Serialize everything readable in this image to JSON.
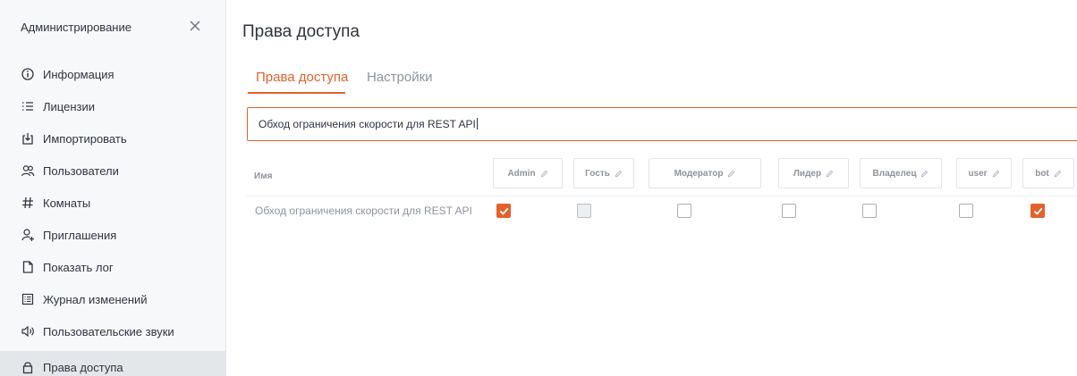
{
  "sidebar": {
    "title": "Администрирование",
    "items": [
      {
        "label": "Информация",
        "icon": "info-icon"
      },
      {
        "label": "Лицензии",
        "icon": "list-icon"
      },
      {
        "label": "Импортировать",
        "icon": "import-icon"
      },
      {
        "label": "Пользователи",
        "icon": "users-icon"
      },
      {
        "label": "Комнаты",
        "icon": "hashtag-icon"
      },
      {
        "label": "Приглашения",
        "icon": "user-plus-icon"
      },
      {
        "label": "Показать лог",
        "icon": "file-icon"
      },
      {
        "label": "Журнал изменений",
        "icon": "journal-icon"
      },
      {
        "label": "Пользовательские звуки",
        "icon": "volume-icon"
      },
      {
        "label": "Права доступа",
        "icon": "lock-icon",
        "active": true
      }
    ]
  },
  "main": {
    "title": "Права доступа",
    "tabs": [
      {
        "label": "Права доступа",
        "active": true
      },
      {
        "label": "Настройки",
        "active": false
      }
    ],
    "search": {
      "value": "Обход ограничения скорости для REST API"
    },
    "table": {
      "name_header": "Имя",
      "roles": [
        "Admin",
        "Гость",
        "Модератор",
        "Лидер",
        "Владелец",
        "user",
        "bot"
      ],
      "rows": [
        {
          "name": "Обход ограничения скорости для REST API",
          "checked": [
            true,
            false,
            false,
            false,
            false,
            false,
            true
          ]
        }
      ]
    }
  },
  "colors": {
    "accent": "#e1622c",
    "sidebar_bg": "#f7f8fa",
    "active_item_bg": "#e4e7ea",
    "muted_text": "#8e949b"
  }
}
